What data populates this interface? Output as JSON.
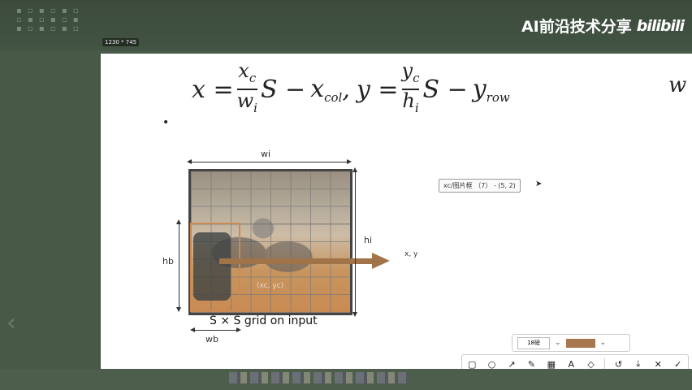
{
  "window": {
    "dims_label": "1230 * 745"
  },
  "brand": {
    "title": "AI前沿技术分享",
    "logo_text": "bilibili"
  },
  "slide": {
    "formula": {
      "x_lhs": "x =",
      "xc_num": "x",
      "xc_sub": "c",
      "wi_den": "w",
      "wi_sub": "i",
      "s1": "S −",
      "xcol": "x",
      "xcol_sub": "col",
      "comma": ",",
      "y_lhs": "y =",
      "yc_num": "y",
      "yc_sub": "c",
      "hi_den": "h",
      "hi_sub": "i",
      "s2": "S −",
      "yrow": "y",
      "yrow_sub": "row",
      "trailing_w": "w"
    },
    "bullet": "•",
    "diagram": {
      "label_wi": "wi",
      "label_hi": "hi",
      "label_hb": "hb",
      "label_wb": "wb",
      "label_xy": "x, y",
      "center_label": "(xc, yc)",
      "caption": "S × S grid on input"
    },
    "tooltip": "xc/图片框 （7） - (5, 2)"
  },
  "annotation_toolbar": {
    "font_size": "18磅",
    "color": "#a9774d",
    "tools": [
      "rectangle-icon",
      "circle-icon",
      "arrow-icon",
      "pen-icon",
      "mosaic-icon",
      "text-icon",
      "eraser-icon",
      "undo-icon",
      "download-icon",
      "close-icon",
      "check-icon"
    ]
  },
  "colors": {
    "accent_arrow": "#a07448",
    "bbox": "#c98a55"
  }
}
